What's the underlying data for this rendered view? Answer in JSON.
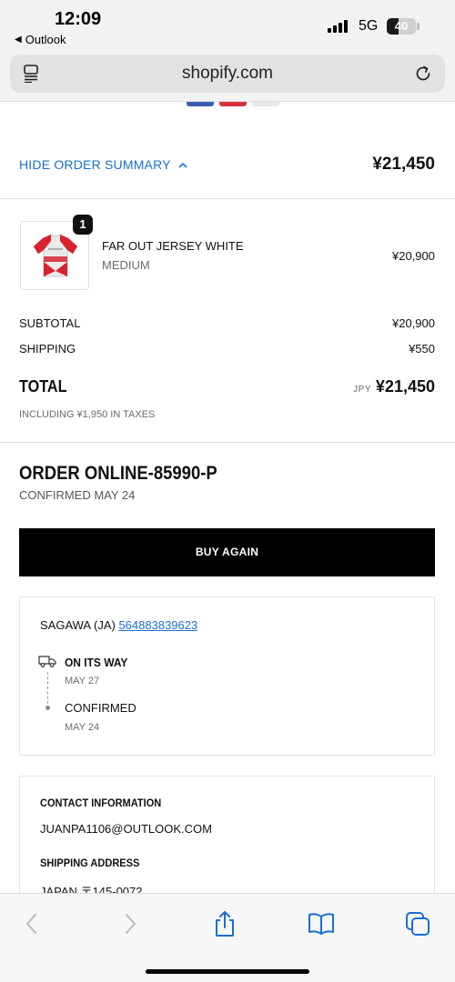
{
  "status_bar": {
    "time": "12:09",
    "back_label": "Outlook",
    "network": "5G",
    "battery": "40",
    "battery_level": 0.4
  },
  "browser": {
    "url": "shopify.com"
  },
  "order_summary": {
    "toggle_label": "HIDE ORDER SUMMARY",
    "header_total": "¥21,450",
    "item": {
      "quantity": "1",
      "name": "FAR OUT JERSEY WHITE",
      "variant": "MEDIUM",
      "price": "¥20,900"
    },
    "subtotal_label": "SUBTOTAL",
    "subtotal_value": "¥20,900",
    "shipping_label": "SHIPPING",
    "shipping_value": "¥550",
    "total_label": "TOTAL",
    "total_currency": "JPY",
    "total_value": "¥21,450",
    "tax_note": "INCLUDING ¥1,950 IN TAXES"
  },
  "order": {
    "title": "ORDER ONLINE-85990-P",
    "confirmed_date": "CONFIRMED MAY 24",
    "buy_again_label": "BUY AGAIN"
  },
  "tracking": {
    "carrier": "SAGAWA (JA)",
    "number": "564883839623",
    "steps": [
      {
        "title": "ON ITS WAY",
        "date": "MAY 27"
      },
      {
        "title": "CONFIRMED",
        "date": "MAY 24"
      }
    ]
  },
  "customer": {
    "contact_heading": "CONTACT INFORMATION",
    "email": "JUANPA1106@OUTLOOK.COM",
    "shipping_heading": "SHIPPING ADDRESS",
    "address_line": "JAPAN 〒145-0072"
  },
  "colors": {
    "link": "#1a6fd0",
    "button": "#000000"
  }
}
